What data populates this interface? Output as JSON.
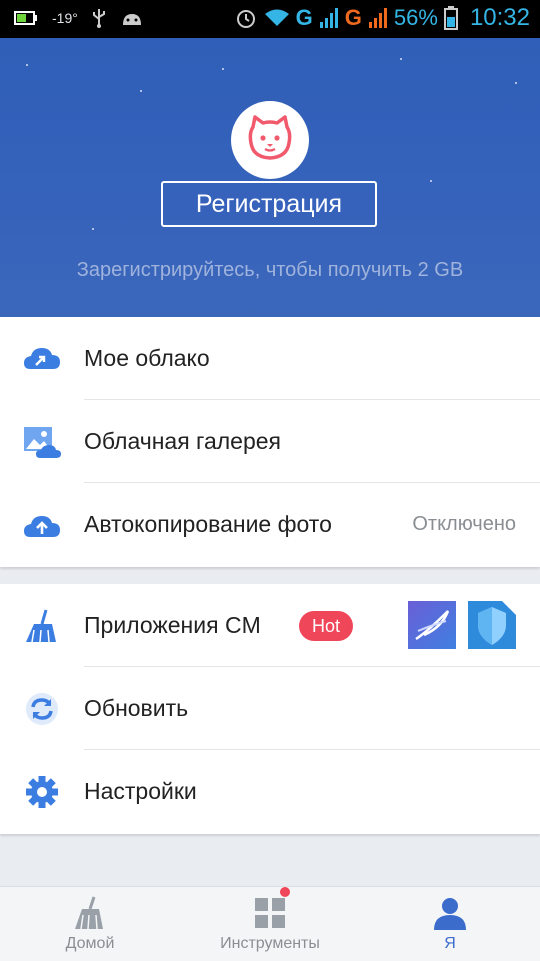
{
  "status_bar": {
    "temperature": "-19°",
    "network_1": "G",
    "network_2": "G",
    "battery": "56%",
    "time": "10:32"
  },
  "header": {
    "register_button": "Регистрация",
    "subtitle": "Зарегистрируйтесь, чтобы получить 2 GB"
  },
  "cloud_section": {
    "items": [
      {
        "label": "Мое облако",
        "icon": "cloud-upload-icon"
      },
      {
        "label": "Облачная галерея",
        "icon": "gallery-cloud-icon"
      },
      {
        "label": "Автокопирование фото",
        "value": "Отключено",
        "icon": "cloud-backup-icon"
      }
    ]
  },
  "apps_section": {
    "items": [
      {
        "label": "Приложения CM",
        "badge": "Hot",
        "icon": "broom-icon"
      },
      {
        "label": "Обновить",
        "icon": "refresh-icon"
      },
      {
        "label": "Настройки",
        "icon": "settings-gear-icon"
      }
    ]
  },
  "bottom_nav": {
    "tabs": [
      {
        "label": "Домой",
        "icon": "broom-icon"
      },
      {
        "label": "Инструменты",
        "icon": "grid-icon"
      },
      {
        "label": "Я",
        "icon": "person-icon",
        "active": true
      }
    ]
  },
  "colors": {
    "accent": "#3b6ccc",
    "header_bg": "#3662bb",
    "badge": "#f0465a"
  }
}
